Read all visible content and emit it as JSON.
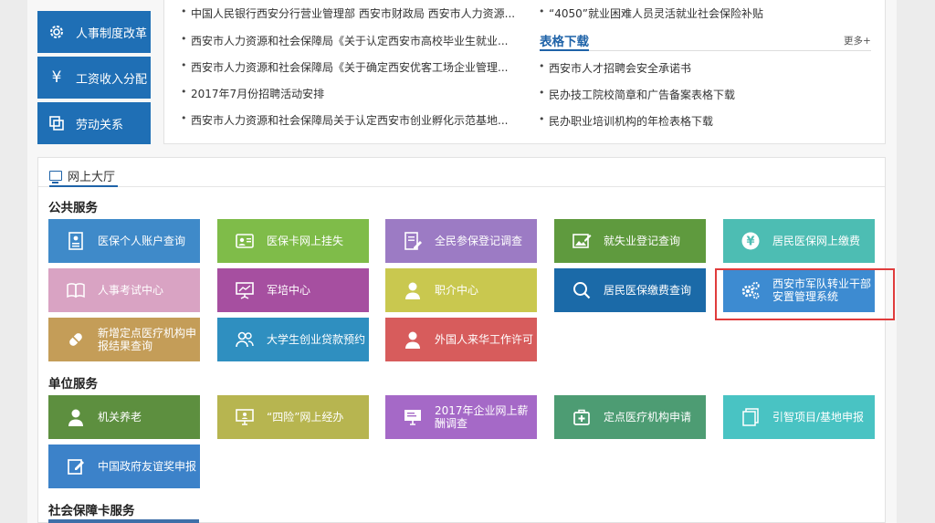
{
  "sidebar": {
    "items": [
      {
        "label": "人事制度改革",
        "icon": "gear-icon"
      },
      {
        "label": "工资收入分配",
        "icon": "yen-icon"
      },
      {
        "label": "劳动关系",
        "icon": "copy-icon"
      }
    ]
  },
  "news": {
    "left": [
      "中国人民银行西安分行营业管理部 西安市财政局 西安市人力资源...",
      "西安市人力资源和社会保障局《关于认定西安市高校毕业生就业...",
      "西安市人力资源和社会保障局《关于确定西安优客工场企业管理...",
      "2017年7月份招聘活动安排",
      "西安市人力资源和社会保障局关于认定西安市创业孵化示范基地..."
    ],
    "right_top": "“4050”就业困难人员灵活就业社会保险补贴",
    "forms_title": "表格下载",
    "more": "更多+",
    "forms": [
      "西安市人才招聘会安全承诺书",
      "民办技工院校简章和广告备案表格下载",
      "民办职业培训机构的年检表格下载"
    ]
  },
  "hall": {
    "tab_label": "网上大厅",
    "public_title": "公共服务",
    "unit_title": "单位服务",
    "social_title": "社会保障卡服务",
    "public_tiles": [
      {
        "label": "医保个人账户查询",
        "color": "#3f8ac9",
        "icon": "id-card-icon"
      },
      {
        "label": "医保卡网上挂失",
        "color": "#7fbc49",
        "icon": "card-user-icon"
      },
      {
        "label": "全民参保登记调查",
        "color": "#9c7bc4",
        "icon": "form-edit-icon"
      },
      {
        "label": "就失业登记查询",
        "color": "#5f9a3e",
        "icon": "image-edit-icon"
      },
      {
        "label": "居民医保网上缴费",
        "color": "#4dbdb3",
        "icon": "yen-circle-icon"
      },
      {
        "label": "人事考试中心",
        "color": "#d9a3c3",
        "icon": "book-icon"
      },
      {
        "label": "军培中心",
        "color": "#a64fa0",
        "icon": "presentation-icon"
      },
      {
        "label": "职介中心",
        "color": "#c9c84f",
        "icon": "person-icon"
      },
      {
        "label": "居民医保缴费查询",
        "color": "#1b6aa8",
        "icon": "search-icon"
      },
      {
        "label": "西安市军队转业干部安置管理系统",
        "color": "#3d8bd1",
        "icon": "gears-icon"
      },
      {
        "label": "新增定点医疗机构申报结果查询",
        "color": "#c49d58",
        "icon": "pill-icon"
      },
      {
        "label": "大学生创业贷款预约",
        "color": "#2f8fc0",
        "icon": "users-icon"
      },
      {
        "label": "外国人来华工作许可",
        "color": "#d75c5c",
        "icon": "person-icon"
      }
    ],
    "unit_tiles": [
      {
        "label": "机关养老",
        "color": "#5d8f3f",
        "icon": "person-icon"
      },
      {
        "label": "“四险”网上经办",
        "color": "#b7b550",
        "icon": "monitor-user-icon"
      },
      {
        "label": "2017年企业网上薪酬调查",
        "color": "#a569c7",
        "icon": "monitor-icon"
      },
      {
        "label": "定点医疗机构申请",
        "color": "#4d9c73",
        "icon": "medkit-icon"
      },
      {
        "label": "引智项目/基地申报",
        "color": "#49c3c3",
        "icon": "files-icon"
      },
      {
        "label": "中国政府友谊奖申报",
        "color": "#3c82c9",
        "icon": "edit-icon"
      }
    ]
  }
}
